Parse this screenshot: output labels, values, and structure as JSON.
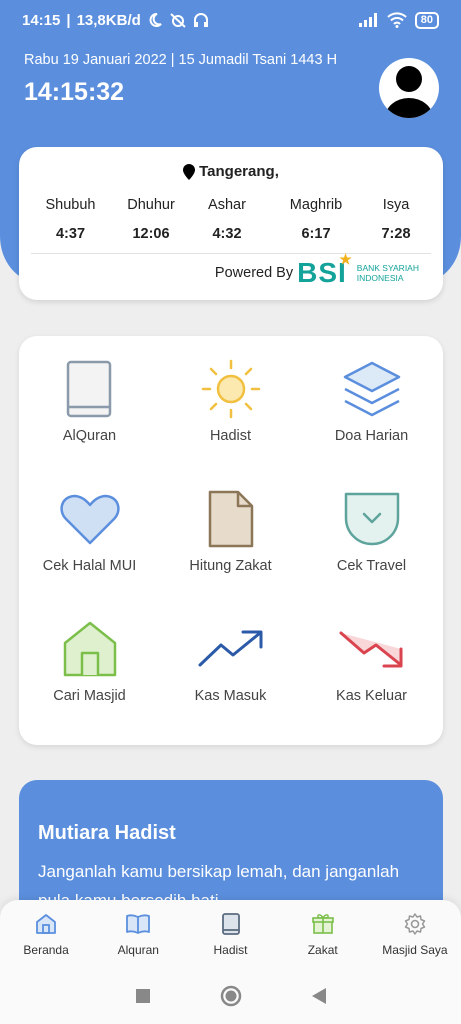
{
  "status_bar": {
    "time": "14:15",
    "speed": "13,8KB/d",
    "battery": "80"
  },
  "header": {
    "date_line": "Rabu 19 Januari 2022 | 15 Jumadil Tsani 1443 H",
    "clock": "14:15:32"
  },
  "prayer": {
    "location": "Tangerang,",
    "times": [
      {
        "name": "Shubuh",
        "time": "4:37"
      },
      {
        "name": "Dhuhur",
        "time": "12:06"
      },
      {
        "name": "Ashar",
        "time": "4:32"
      },
      {
        "name": "Maghrib",
        "time": "6:17"
      },
      {
        "name": "Isya",
        "time": "7:28"
      }
    ],
    "powered_by": "Powered By",
    "bsi_logo": "BSI",
    "bsi_sub1": "BANK SYARIAH",
    "bsi_sub2": "INDONESIA"
  },
  "menu": {
    "items": [
      {
        "label": "AlQuran",
        "icon": "book-icon"
      },
      {
        "label": "Hadist",
        "icon": "sun-icon"
      },
      {
        "label": "Doa Harian",
        "icon": "layers-icon"
      },
      {
        "label": "Cek Halal MUI",
        "icon": "heart-icon"
      },
      {
        "label": "Hitung Zakat",
        "icon": "document-icon"
      },
      {
        "label": "Cek Travel",
        "icon": "pocket-icon"
      },
      {
        "label": "Cari Masjid",
        "icon": "home-icon"
      },
      {
        "label": "Kas Masuk",
        "icon": "trending-up-icon"
      },
      {
        "label": "Kas Keluar",
        "icon": "trending-down-icon"
      }
    ]
  },
  "hadist": {
    "title": "Mutiara Hadist",
    "text": "Janganlah kamu bersikap lemah, dan janganlah pula kamu bersedih hati"
  },
  "bottom_nav": {
    "items": [
      {
        "label": "Beranda",
        "icon": "home-icon"
      },
      {
        "label": "Alquran",
        "icon": "open-book-icon"
      },
      {
        "label": "Hadist",
        "icon": "book-icon"
      },
      {
        "label": "Zakat",
        "icon": "gift-icon"
      },
      {
        "label": "Masjid Saya",
        "icon": "gear-icon"
      }
    ]
  },
  "colors": {
    "primary": "#5b8fde",
    "bsi_teal": "#14a39a",
    "bsi_gold": "#f2b11e"
  }
}
